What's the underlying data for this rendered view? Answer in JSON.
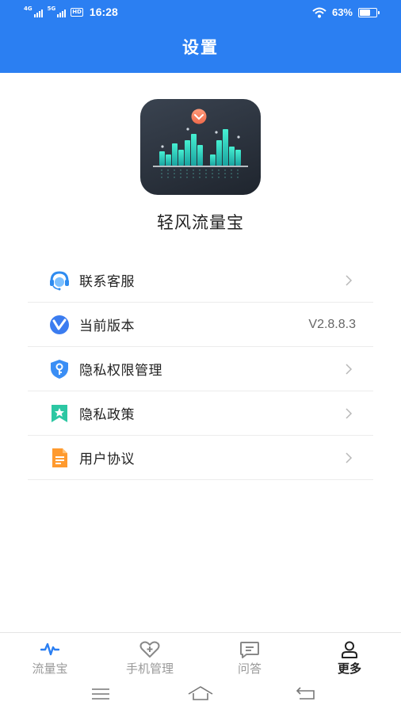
{
  "status_bar": {
    "signal1_label": "4G",
    "signal2_label": "5G",
    "hd_label": "HD",
    "time": "16:28",
    "battery_text": "63%",
    "battery_level": 0.63
  },
  "header": {
    "title": "设置"
  },
  "app": {
    "name": "轻风流量宝",
    "logo_icon": "bar-chart-logo"
  },
  "settings": {
    "items": [
      {
        "label": "联系客服",
        "icon": "headset-icon"
      },
      {
        "label": "当前版本",
        "icon": "version-v-icon",
        "value": "V2.8.8.3"
      },
      {
        "label": "隐私权限管理",
        "icon": "shield-key-icon"
      },
      {
        "label": "隐私政策",
        "icon": "bookmark-star-icon"
      },
      {
        "label": "用户协议",
        "icon": "document-icon"
      }
    ]
  },
  "tabbar": {
    "tabs": [
      {
        "label": "流量宝",
        "icon": "pulse-icon",
        "active": false
      },
      {
        "label": "手机管理",
        "icon": "heart-plus-icon",
        "active": false
      },
      {
        "label": "问答",
        "icon": "chat-bubble-icon",
        "active": false
      },
      {
        "label": "更多",
        "icon": "person-icon",
        "active": true
      }
    ]
  },
  "colors": {
    "header_bg": "#2b7ff2",
    "accent": "#2b7ff2",
    "divider": "#ececec"
  }
}
